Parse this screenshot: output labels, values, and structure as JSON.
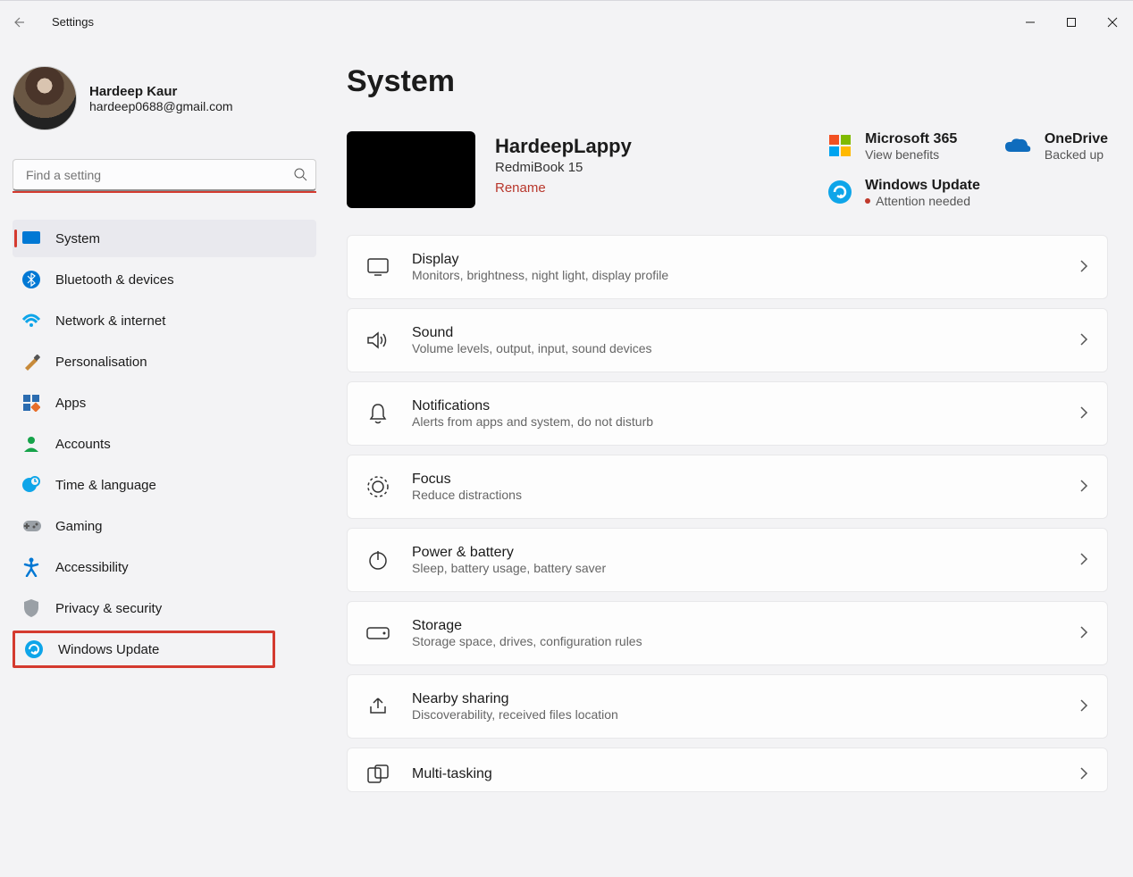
{
  "window": {
    "title": "Settings"
  },
  "user": {
    "name": "Hardeep Kaur",
    "email": "hardeep0688@gmail.com"
  },
  "search": {
    "placeholder": "Find a setting"
  },
  "nav": [
    {
      "id": "system",
      "label": "System",
      "selected": true
    },
    {
      "id": "bluetooth",
      "label": "Bluetooth & devices"
    },
    {
      "id": "network",
      "label": "Network & internet"
    },
    {
      "id": "personalisation",
      "label": "Personalisation"
    },
    {
      "id": "apps",
      "label": "Apps"
    },
    {
      "id": "accounts",
      "label": "Accounts"
    },
    {
      "id": "time",
      "label": "Time & language"
    },
    {
      "id": "gaming",
      "label": "Gaming"
    },
    {
      "id": "accessibility",
      "label": "Accessibility"
    },
    {
      "id": "privacy",
      "label": "Privacy & security"
    },
    {
      "id": "windowsupdate",
      "label": "Windows Update",
      "highlighted": true
    }
  ],
  "page": {
    "title": "System",
    "device": {
      "name": "HardeepLappy",
      "model": "RedmiBook 15",
      "rename": "Rename"
    },
    "status": {
      "m365": {
        "title": "Microsoft 365",
        "sub": "View benefits"
      },
      "onedrive": {
        "title": "OneDrive",
        "sub": "Backed up"
      },
      "wu": {
        "title": "Windows Update",
        "sub": "Attention needed"
      }
    },
    "cards": [
      {
        "id": "display",
        "title": "Display",
        "sub": "Monitors, brightness, night light, display profile"
      },
      {
        "id": "sound",
        "title": "Sound",
        "sub": "Volume levels, output, input, sound devices"
      },
      {
        "id": "notifications",
        "title": "Notifications",
        "sub": "Alerts from apps and system, do not disturb"
      },
      {
        "id": "focus",
        "title": "Focus",
        "sub": "Reduce distractions"
      },
      {
        "id": "power",
        "title": "Power & battery",
        "sub": "Sleep, battery usage, battery saver"
      },
      {
        "id": "storage",
        "title": "Storage",
        "sub": "Storage space, drives, configuration rules"
      },
      {
        "id": "nearby",
        "title": "Nearby sharing",
        "sub": "Discoverability, received files location"
      },
      {
        "id": "multitasking",
        "title": "Multi-tasking",
        "sub": ""
      }
    ]
  }
}
